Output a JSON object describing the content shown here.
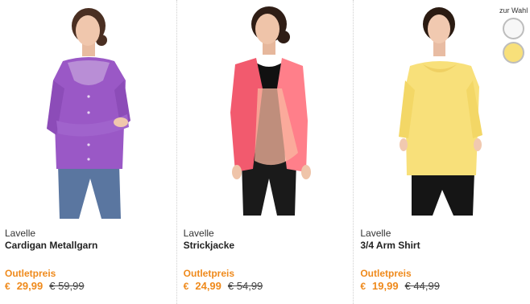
{
  "products": [
    {
      "brand": "Lavelle",
      "name": "Cardigan Metallgarn",
      "price_label": "Outletpreis",
      "currency": "€",
      "price": "29,99",
      "old_price": "€ 59,99",
      "garment_color": "#9a58c6"
    },
    {
      "brand": "Lavelle",
      "name": "Strickjacke",
      "price_label": "Outletpreis",
      "currency": "€",
      "price": "24,99",
      "old_price": "€ 54,99",
      "garment_color": "#f25a6e"
    },
    {
      "brand": "Lavelle",
      "name": "3/4 Arm Shirt",
      "price_label": "Outletpreis",
      "currency": "€",
      "price": "19,99",
      "old_price": "€ 44,99",
      "garment_color": "#f8e07a"
    }
  ],
  "color_choice": {
    "label": "zur Wahl",
    "colors": [
      "#f7f7f7",
      "#f8e07a"
    ]
  },
  "accent_color": "#ef8a1c"
}
